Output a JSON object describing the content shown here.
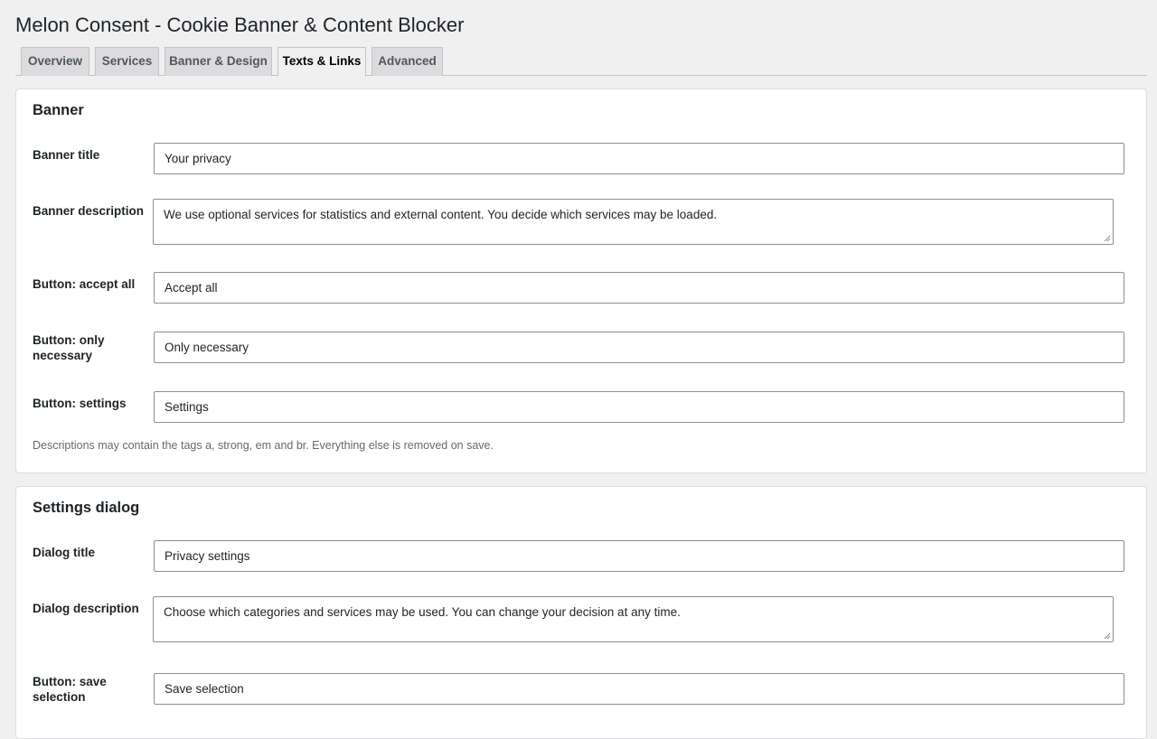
{
  "page": {
    "title": "Melon Consent - Cookie Banner & Content Blocker"
  },
  "tabs": [
    {
      "label": "Overview",
      "active": false
    },
    {
      "label": "Services",
      "active": false
    },
    {
      "label": "Banner & Design",
      "active": false
    },
    {
      "label": "Texts & Links",
      "active": true
    },
    {
      "label": "Advanced",
      "active": false
    }
  ],
  "banner_section": {
    "title": "Banner",
    "fields": {
      "banner_title": {
        "label": "Banner title",
        "value": "Your privacy"
      },
      "banner_description": {
        "label": "Banner description",
        "value": "We use optional services for statistics and external content. You decide which services may be loaded."
      },
      "accept_all": {
        "label": "Button: accept all",
        "value": "Accept all"
      },
      "only_necessary": {
        "label": "Button: only necessary",
        "value": "Only necessary"
      },
      "settings": {
        "label": "Button: settings",
        "value": "Settings"
      }
    },
    "hint": "Descriptions may contain the tags a, strong, em and br. Everything else is removed on save."
  },
  "dialog_section": {
    "title": "Settings dialog",
    "fields": {
      "dialog_title": {
        "label": "Dialog title",
        "value": "Privacy settings"
      },
      "dialog_description": {
        "label": "Dialog description",
        "value": "Choose which categories and services may be used. You can change your decision at any time."
      },
      "save_selection": {
        "label": "Button: save selection",
        "value": "Save selection"
      }
    }
  },
  "colors": {
    "background": "#f0f0f1",
    "card": "#ffffff",
    "border": "#8c8f94",
    "text": "#1d2327",
    "muted": "#646970"
  }
}
